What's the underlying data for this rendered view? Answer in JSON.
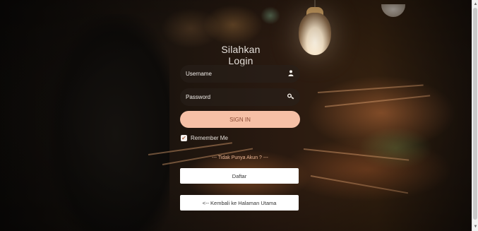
{
  "login": {
    "title": "Silahkan Login",
    "username_placeholder": "Username",
    "password_placeholder": "Password",
    "signin_label": "SIGN IN",
    "remember_label": "Remember Me",
    "remember_checked": true,
    "no_account_text": "--- Tidak Punya Akun ? ---",
    "register_label": "Daftar",
    "back_label": "<-- Kembali ke Halaman Utama"
  },
  "icons": {
    "username": "user-icon",
    "password": "key-icon",
    "remember": "check-icon"
  },
  "colors": {
    "signin_bg": "#f6c0a6",
    "signin_text": "#8a4a34",
    "accent_text": "#e9b493"
  }
}
